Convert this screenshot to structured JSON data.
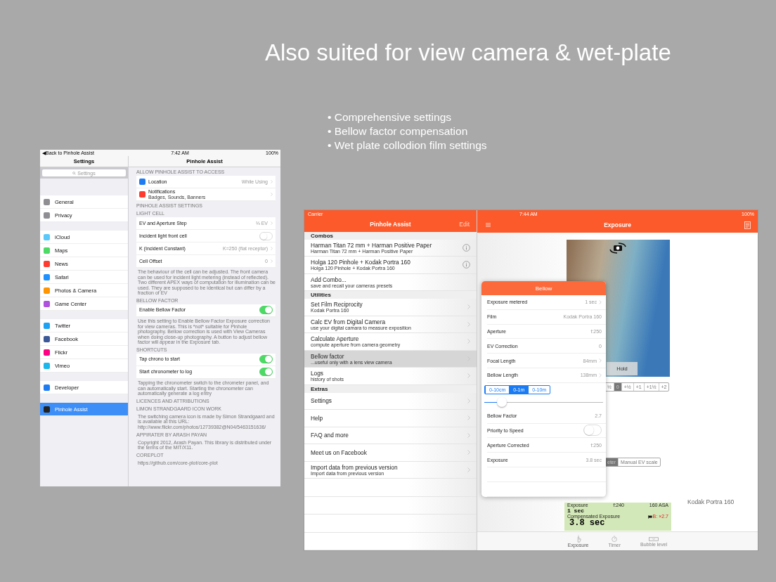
{
  "headline": "Also suited for view camera & wet-plate",
  "bullets": [
    "• Comprehensive settings",
    "• Bellow factor compensation",
    "• Wet plate collodion film settings"
  ],
  "settings_screen": {
    "status_bar": {
      "back": "◀Back to Pinhole Assist",
      "time": "7:42 AM",
      "battery": "100%"
    },
    "sidebar": {
      "title": "Settings",
      "search": {
        "placeholder": "Settings"
      },
      "groups": [
        [
          {
            "label": "General",
            "color": "#8e8e93",
            "selected": false
          },
          {
            "label": "Privacy",
            "color": "#8e8e93",
            "selected": false
          }
        ],
        [
          {
            "label": "iCloud",
            "color": "#5ac8fa",
            "selected": false
          },
          {
            "label": "Maps",
            "color": "#4cd964",
            "selected": false
          },
          {
            "label": "News",
            "color": "#ff3b30",
            "selected": false
          },
          {
            "label": "Safari",
            "color": "#1e90ff",
            "selected": false
          },
          {
            "label": "Photos & Camera",
            "color": "#ff9500",
            "selected": false
          },
          {
            "label": "Game Center",
            "color": "#af52de",
            "selected": false
          }
        ],
        [
          {
            "label": "Twitter",
            "color": "#1da1f2",
            "selected": false
          },
          {
            "label": "Facebook",
            "color": "#3b5998",
            "selected": false
          },
          {
            "label": "Flickr",
            "color": "#ff0084",
            "selected": false
          },
          {
            "label": "Vimeo",
            "color": "#1ab7ea",
            "selected": false
          }
        ],
        [
          {
            "label": "Developer",
            "color": "#1e7cf2",
            "selected": false
          }
        ],
        [
          {
            "label": "Pinhole Assist",
            "color": "#222222",
            "selected": true
          }
        ]
      ]
    },
    "detail": {
      "title": "Pinhole Assist",
      "sections": [
        {
          "header": "ALLOW PINHOLE ASSIST TO ACCESS",
          "rows": [
            {
              "kind": "nav",
              "label": "Location",
              "value": "While Using",
              "color": "#1e7cf2"
            },
            {
              "kind": "nav",
              "label": "Notifications",
              "subtitle": "Badges, Sounds, Banners",
              "color": "#ff3b30"
            }
          ]
        },
        {
          "header": "PINHOLE ASSIST SETTINGS"
        },
        {
          "header": "LIGHT CELL",
          "rows": [
            {
              "kind": "nav",
              "label": "EV and Aperture Step",
              "value": "⅓ EV"
            },
            {
              "kind": "toggle",
              "label": "Incident light front cell",
              "on": false
            },
            {
              "kind": "nav",
              "label": "K (Incident Constant)",
              "value": "K=250 (flat receptor)"
            },
            {
              "kind": "nav",
              "label": "Cell Offset",
              "value": "0"
            }
          ],
          "footer": "The behaviour of the cell can be adjusted. The front camera can be used for incident light metering (instead of reflected). Two different APEX ways of computation for illumination can be used. They are supposed to be identical but can differ by a fraction of EV"
        },
        {
          "header": "BELLOW FACTOR",
          "rows": [
            {
              "kind": "toggle",
              "label": "Enable Bellow Factor",
              "on": true
            }
          ],
          "footer": "Use this setting to Enable Bellow Factor Exposure correction for view cameras. This is *not* suitable for Pinhole photography. Bellow correction is used with View Cameras when doing close-up photography. A button to adjust bellow factor will appear in the Exposure tab."
        },
        {
          "header": "SHORTCUTS",
          "rows": [
            {
              "kind": "toggle",
              "label": "Tap chrono to start",
              "on": true
            },
            {
              "kind": "toggle",
              "label": "Start chronometer to log",
              "on": true
            }
          ],
          "footer": "Tapping the chronometer switch to the chrometer panel, and can automatically start. Starting the chronometer can  automatically generate a log entry"
        },
        {
          "header": "LICENCES AND ATTRIBUTIONS"
        },
        {
          "header": "LIMON STRANDGAARD ICON WORK",
          "footer": "The switching camera icon is made by Simon Strandgaard and is available at this URL:  http://www.flickr.com/photos/12739382@N04/5463151636/"
        },
        {
          "header": "APPIRATER BY ARASH PAYAN",
          "footer": "Copyright 2012, Arash Payan. This library is distributed under the terms of the MIT/X11."
        },
        {
          "header": "COREPLOT",
          "footer": "https://github.com/core-plot/core-plot"
        }
      ]
    }
  },
  "app_screen": {
    "master": {
      "carrier": "Carrier",
      "title": "Pinhole Assist",
      "edit": "Edit",
      "sections": [
        {
          "header": "Combos",
          "rows": [
            {
              "kind": "info",
              "title": "Harman Titan 72 mm + Harman Positive Paper",
              "subtitle": "Harman Titan 72 mm + Harman Positive Paper",
              "selected": false
            },
            {
              "kind": "info",
              "title": "Holga 120 Pinhole + Kodak Portra 160",
              "subtitle": "Holga 120 Pinhole + Kodak Portra 160",
              "selected": false
            },
            {
              "kind": "plain",
              "title": "Add Combo...",
              "subtitle": "save  and recall your cameras presets",
              "selected": false
            }
          ]
        },
        {
          "header": "Utilities",
          "rows": [
            {
              "kind": "nav",
              "title": "Set Film Reciprocity",
              "subtitle": "Kodak Portra 160",
              "selected": false
            },
            {
              "kind": "nav",
              "title": "Calc EV from Digital Camera",
              "subtitle": "use your digital camara to measure exposition",
              "selected": false
            },
            {
              "kind": "nav",
              "title": "Calculate Aperture",
              "subtitle": "compute aperture from camera geometry",
              "selected": false
            },
            {
              "kind": "nav",
              "title": "Bellow factor",
              "subtitle": "...useful only with a lens view camera",
              "selected": true
            },
            {
              "kind": "nav",
              "title": "Logs",
              "subtitle": "history of shots",
              "selected": false
            }
          ]
        },
        {
          "header": "Extras",
          "rows": [
            {
              "kind": "nav",
              "title": "Settings",
              "selected": false
            },
            {
              "kind": "nav",
              "title": "Help",
              "selected": false
            },
            {
              "kind": "nav",
              "title": "FAQ and more",
              "selected": false
            },
            {
              "kind": "nav",
              "title": "Meet us on Facebook",
              "selected": false
            },
            {
              "kind": "nav",
              "title": "Import data from previous version",
              "subtitle": "Import data from previous version",
              "selected": false
            }
          ]
        }
      ]
    },
    "detail": {
      "time": "7:44 AM",
      "battery": "100%",
      "title": "Exposure",
      "hold": "Hold",
      "ev_scale": [
        {
          "label": "½",
          "selected": false
        },
        {
          "label": "0",
          "selected": true
        },
        {
          "label": "+½",
          "selected": false
        },
        {
          "label": "+1",
          "selected": false
        },
        {
          "label": "+1½",
          "selected": false
        },
        {
          "label": "+2",
          "selected": false
        }
      ],
      "mode": [
        {
          "label": "eter",
          "selected": true
        },
        {
          "label": "Manual EV scale",
          "selected": false
        }
      ],
      "film": "Kodak Portra 160",
      "lcd": {
        "label": "Exposure",
        "aperture": "f:240",
        "iso": "160 ASA",
        "metered": "1 sec",
        "compensated_label": "Compensated Exposure",
        "compensated": "3.8 sec",
        "bellow": "B: ×2.7"
      },
      "tabs": [
        {
          "label": "Exposure",
          "selected": true
        },
        {
          "label": "Timer",
          "selected": false
        },
        {
          "label": "Bubble level",
          "selected": false
        }
      ]
    },
    "popover": {
      "title": "Bellow",
      "rows": [
        {
          "kind": "nav",
          "label": "Exposure metered",
          "value": "1 sec"
        },
        {
          "kind": "value",
          "label": "Film",
          "value": "Kodak Portra 160"
        },
        {
          "kind": "value",
          "label": "Aperture",
          "value": "f:250"
        },
        {
          "kind": "value",
          "label": "EV Correction",
          "value": "0"
        },
        {
          "kind": "nav",
          "label": "Focal Length",
          "value": "84mm"
        },
        {
          "kind": "nav",
          "label": "Bellow Length",
          "value": "138mm"
        }
      ],
      "range": [
        {
          "label": "0-10cm",
          "selected": false
        },
        {
          "label": "0-1m",
          "selected": true
        },
        {
          "label": "0-10m",
          "selected": false
        }
      ],
      "slider": {
        "level": 0.15
      },
      "rows2": [
        {
          "kind": "value",
          "label": "Bellow Factor",
          "value": "2.7"
        },
        {
          "kind": "toggle",
          "label": "Priority to Speed",
          "on": false
        },
        {
          "kind": "value",
          "label": "Aperture Corrected",
          "value": "f:250"
        },
        {
          "kind": "value",
          "label": "Exposure",
          "value": "3.8 sec"
        }
      ]
    }
  }
}
